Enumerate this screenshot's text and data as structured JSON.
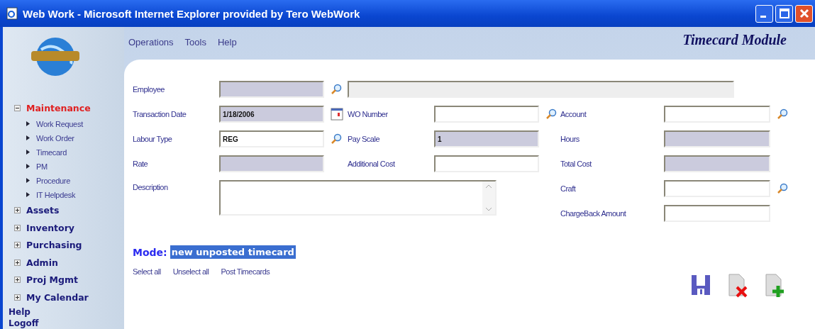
{
  "window": {
    "title": "Web Work - Microsoft Internet Explorer provided by Tero WebWork"
  },
  "sidebar": {
    "items": [
      {
        "label": "Maintenance",
        "kind": "group",
        "expanded": true,
        "children": [
          {
            "label": "Work Request"
          },
          {
            "label": "Work Order"
          },
          {
            "label": "Timecard"
          },
          {
            "label": "PM"
          },
          {
            "label": "Procedure"
          },
          {
            "label": "IT Helpdesk"
          }
        ]
      },
      {
        "label": "Assets",
        "kind": "group",
        "expanded": false
      },
      {
        "label": "Inventory",
        "kind": "group",
        "expanded": false
      },
      {
        "label": "Purchasing",
        "kind": "group",
        "expanded": false
      },
      {
        "label": "Admin",
        "kind": "group",
        "expanded": false
      },
      {
        "label": "Proj Mgmt",
        "kind": "group",
        "expanded": false
      },
      {
        "label": "My Calendar",
        "kind": "group",
        "expanded": false
      },
      {
        "label": "Help",
        "kind": "link"
      },
      {
        "label": "Logoff",
        "kind": "link"
      }
    ]
  },
  "menu": [
    "Operations",
    "Tools",
    "Help"
  ],
  "module_title": "Timecard Module",
  "form": {
    "rows": [
      [
        {
          "label": "Employee",
          "kind": "lookup",
          "shaded": true
        },
        {
          "kind": "display"
        }
      ],
      [
        {
          "label": "Transaction Date",
          "kind": "date",
          "value": "1/18/2006",
          "shaded": true
        },
        {
          "label": "WO Number",
          "kind": "lookup",
          "shaded": false
        },
        {
          "label": "Account",
          "kind": "lookup",
          "shaded": false
        }
      ],
      [
        {
          "label": "Labour Type",
          "kind": "lookup",
          "value": "REG",
          "shaded": false
        },
        {
          "label": "Pay Scale",
          "kind": "text",
          "value": "1",
          "shaded": true
        },
        {
          "label": "Hours",
          "kind": "text",
          "shaded": true
        }
      ],
      [
        {
          "label": "Rate",
          "kind": "text",
          "shaded": true
        },
        {
          "label": "Additional Cost",
          "kind": "text",
          "shaded": false
        },
        {
          "label": "Total Cost",
          "kind": "text",
          "shaded": true
        }
      ],
      [
        {
          "label": "Description",
          "kind": "textarea",
          "shaded": false
        },
        "",
        {
          "label": "Craft",
          "kind": "lookup",
          "shaded": false
        }
      ],
      [
        "",
        "",
        {
          "label": "ChargeBack Amount",
          "kind": "text",
          "shaded": false
        }
      ]
    ]
  },
  "mode": {
    "label": "Mode:",
    "value": "new unposted timecard"
  },
  "links": [
    "Select all",
    "Unselect all",
    "Post Timecards"
  ],
  "actions": [
    {
      "kind": "save"
    },
    {
      "kind": "delete"
    },
    {
      "kind": "new"
    }
  ]
}
